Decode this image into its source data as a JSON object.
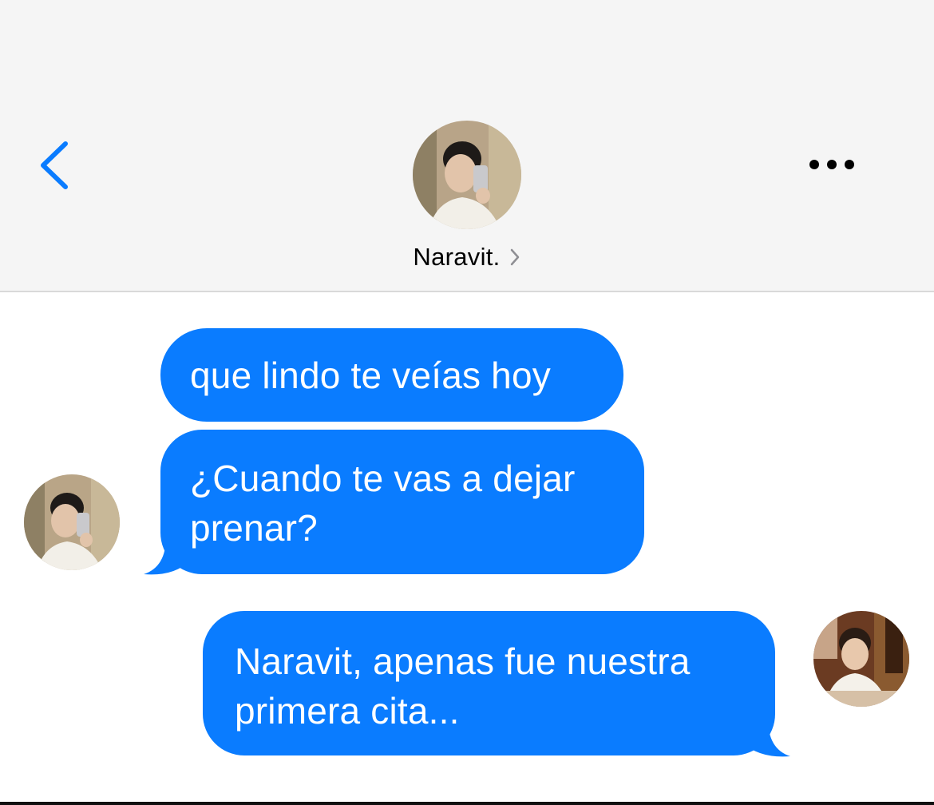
{
  "header": {
    "contact_name": "Naravit.",
    "back_icon": "chevron-left-icon",
    "more_icon": "more-horizontal-icon",
    "accent_color": "#0a7cff"
  },
  "messages": [
    {
      "sender": "contact",
      "text": "que lindo te veías hoy"
    },
    {
      "sender": "contact",
      "text": "¿Cuando te vas a dejar prenar?"
    },
    {
      "sender": "me",
      "text": "Naravit, apenas fue nuestra primera cita..."
    }
  ],
  "bubble_color": "#0a7cff"
}
